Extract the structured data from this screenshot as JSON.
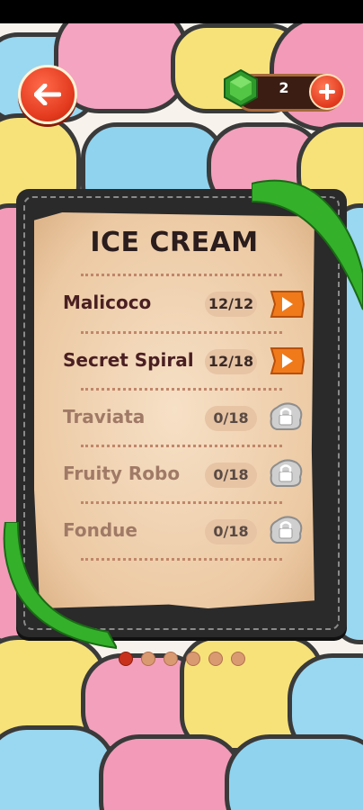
{
  "screen": {
    "title": "ICE CREAM"
  },
  "header": {
    "back_icon": "arrow-left-icon",
    "gem_icon": "green-gem-icon",
    "gem_count": "2",
    "plus_icon": "plus-icon"
  },
  "levels": [
    {
      "name": "Malicoco",
      "progress": "12/12",
      "state": "unlocked",
      "action_icon": "play-icon"
    },
    {
      "name": "Secret Spiral",
      "progress": "12/18",
      "state": "unlocked",
      "action_icon": "play-icon"
    },
    {
      "name": "Traviata",
      "progress": "0/18",
      "state": "locked",
      "action_icon": "lock-icon"
    },
    {
      "name": "Fruity Robo",
      "progress": "0/18",
      "state": "locked",
      "action_icon": "lock-icon"
    },
    {
      "name": "Fondue",
      "progress": "0/18",
      "state": "locked",
      "action_icon": "lock-icon"
    }
  ],
  "pagination": {
    "total": 6,
    "active_index": 0
  },
  "colors": {
    "accent_orange": "#f07a1a",
    "back_red": "#e33a1e",
    "ribbon_green": "#35b52a",
    "board_dark": "#2a2a2a",
    "paper": "#f1d2b1"
  }
}
